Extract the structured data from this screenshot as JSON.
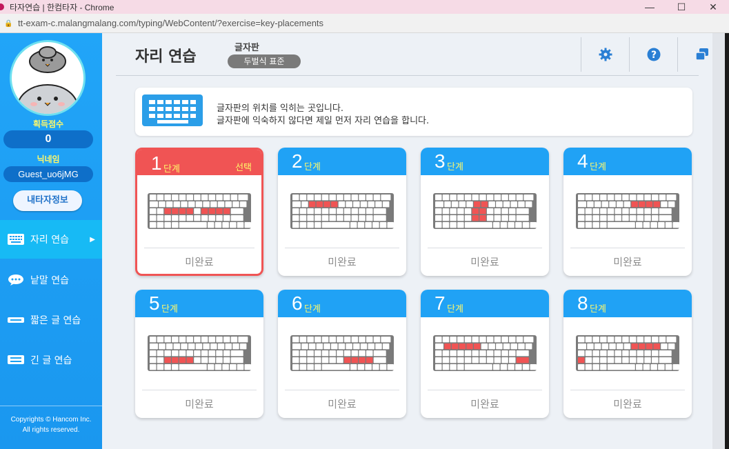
{
  "window": {
    "title": "타자연습 | 한컴타자 - Chrome",
    "url": "tt-exam-c.malangmalang.com/typing/WebContent/?exercise=key-placements"
  },
  "sidebar": {
    "score_label": "획득점수",
    "score_value": "0",
    "nickname_label": "닉네임",
    "nickname_value": "Guest_uo6jMG",
    "myinfo_button": "내타자정보",
    "menu": [
      {
        "label": "자리 연습",
        "icon": "keyboard-icon",
        "active": true
      },
      {
        "label": "낱말 연습",
        "icon": "speech-bubble-icon",
        "active": false
      },
      {
        "label": "짧은 글 연습",
        "icon": "short-text-icon",
        "active": false
      },
      {
        "label": "긴 글 연습",
        "icon": "long-text-icon",
        "active": false
      }
    ],
    "copyright_line1": "Copyrights © Hancom Inc.",
    "copyright_line2": "All rights reserved."
  },
  "header": {
    "title": "자리 연습",
    "keyboard_label": "글자판",
    "keyboard_layout": "두벌식 표준",
    "buttons": [
      "gear-icon",
      "help-icon",
      "window-icon"
    ]
  },
  "info": {
    "line1": "글자판의 위치를 익히는 곳입니다.",
    "line2": "글자판에 익숙하지 않다면 제일 먼저 자리 연습을 합니다."
  },
  "stages": [
    {
      "num": "1",
      "unit": "단계",
      "selected_label": "선택",
      "status": "미완료",
      "selected": true
    },
    {
      "num": "2",
      "unit": "단계",
      "status": "미완료",
      "selected": false
    },
    {
      "num": "3",
      "unit": "단계",
      "status": "미완료",
      "selected": false
    },
    {
      "num": "4",
      "unit": "단계",
      "status": "미완료",
      "selected": false
    },
    {
      "num": "5",
      "unit": "단계",
      "status": "미완료",
      "selected": false
    },
    {
      "num": "6",
      "unit": "단계",
      "status": "미완료",
      "selected": false
    },
    {
      "num": "7",
      "unit": "단계",
      "status": "미완료",
      "selected": false
    },
    {
      "num": "8",
      "unit": "단계",
      "status": "미완료",
      "selected": false
    }
  ],
  "colors": {
    "sidebar": "#21a5f8",
    "stage_header": "#20a2f5",
    "selected": "#f05454",
    "highlight_key": "#f05454"
  }
}
